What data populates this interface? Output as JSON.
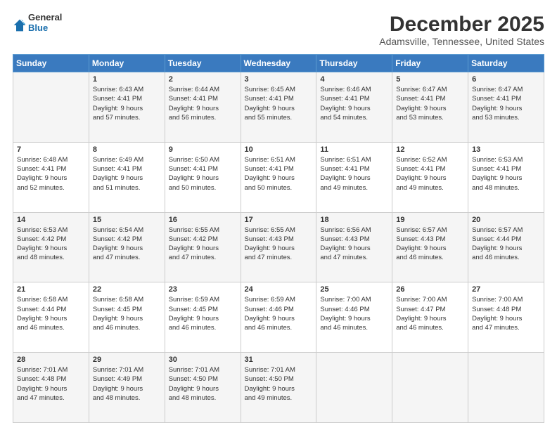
{
  "logo": {
    "line1": "General",
    "line2": "Blue"
  },
  "title": "December 2025",
  "location": "Adamsville, Tennessee, United States",
  "headers": [
    "Sunday",
    "Monday",
    "Tuesday",
    "Wednesday",
    "Thursday",
    "Friday",
    "Saturday"
  ],
  "weeks": [
    [
      {
        "day": "",
        "info": ""
      },
      {
        "day": "1",
        "info": "Sunrise: 6:43 AM\nSunset: 4:41 PM\nDaylight: 9 hours\nand 57 minutes."
      },
      {
        "day": "2",
        "info": "Sunrise: 6:44 AM\nSunset: 4:41 PM\nDaylight: 9 hours\nand 56 minutes."
      },
      {
        "day": "3",
        "info": "Sunrise: 6:45 AM\nSunset: 4:41 PM\nDaylight: 9 hours\nand 55 minutes."
      },
      {
        "day": "4",
        "info": "Sunrise: 6:46 AM\nSunset: 4:41 PM\nDaylight: 9 hours\nand 54 minutes."
      },
      {
        "day": "5",
        "info": "Sunrise: 6:47 AM\nSunset: 4:41 PM\nDaylight: 9 hours\nand 53 minutes."
      },
      {
        "day": "6",
        "info": "Sunrise: 6:47 AM\nSunset: 4:41 PM\nDaylight: 9 hours\nand 53 minutes."
      }
    ],
    [
      {
        "day": "7",
        "info": "Sunrise: 6:48 AM\nSunset: 4:41 PM\nDaylight: 9 hours\nand 52 minutes."
      },
      {
        "day": "8",
        "info": "Sunrise: 6:49 AM\nSunset: 4:41 PM\nDaylight: 9 hours\nand 51 minutes."
      },
      {
        "day": "9",
        "info": "Sunrise: 6:50 AM\nSunset: 4:41 PM\nDaylight: 9 hours\nand 50 minutes."
      },
      {
        "day": "10",
        "info": "Sunrise: 6:51 AM\nSunset: 4:41 PM\nDaylight: 9 hours\nand 50 minutes."
      },
      {
        "day": "11",
        "info": "Sunrise: 6:51 AM\nSunset: 4:41 PM\nDaylight: 9 hours\nand 49 minutes."
      },
      {
        "day": "12",
        "info": "Sunrise: 6:52 AM\nSunset: 4:41 PM\nDaylight: 9 hours\nand 49 minutes."
      },
      {
        "day": "13",
        "info": "Sunrise: 6:53 AM\nSunset: 4:41 PM\nDaylight: 9 hours\nand 48 minutes."
      }
    ],
    [
      {
        "day": "14",
        "info": "Sunrise: 6:53 AM\nSunset: 4:42 PM\nDaylight: 9 hours\nand 48 minutes."
      },
      {
        "day": "15",
        "info": "Sunrise: 6:54 AM\nSunset: 4:42 PM\nDaylight: 9 hours\nand 47 minutes."
      },
      {
        "day": "16",
        "info": "Sunrise: 6:55 AM\nSunset: 4:42 PM\nDaylight: 9 hours\nand 47 minutes."
      },
      {
        "day": "17",
        "info": "Sunrise: 6:55 AM\nSunset: 4:43 PM\nDaylight: 9 hours\nand 47 minutes."
      },
      {
        "day": "18",
        "info": "Sunrise: 6:56 AM\nSunset: 4:43 PM\nDaylight: 9 hours\nand 47 minutes."
      },
      {
        "day": "19",
        "info": "Sunrise: 6:57 AM\nSunset: 4:43 PM\nDaylight: 9 hours\nand 46 minutes."
      },
      {
        "day": "20",
        "info": "Sunrise: 6:57 AM\nSunset: 4:44 PM\nDaylight: 9 hours\nand 46 minutes."
      }
    ],
    [
      {
        "day": "21",
        "info": "Sunrise: 6:58 AM\nSunset: 4:44 PM\nDaylight: 9 hours\nand 46 minutes."
      },
      {
        "day": "22",
        "info": "Sunrise: 6:58 AM\nSunset: 4:45 PM\nDaylight: 9 hours\nand 46 minutes."
      },
      {
        "day": "23",
        "info": "Sunrise: 6:59 AM\nSunset: 4:45 PM\nDaylight: 9 hours\nand 46 minutes."
      },
      {
        "day": "24",
        "info": "Sunrise: 6:59 AM\nSunset: 4:46 PM\nDaylight: 9 hours\nand 46 minutes."
      },
      {
        "day": "25",
        "info": "Sunrise: 7:00 AM\nSunset: 4:46 PM\nDaylight: 9 hours\nand 46 minutes."
      },
      {
        "day": "26",
        "info": "Sunrise: 7:00 AM\nSunset: 4:47 PM\nDaylight: 9 hours\nand 46 minutes."
      },
      {
        "day": "27",
        "info": "Sunrise: 7:00 AM\nSunset: 4:48 PM\nDaylight: 9 hours\nand 47 minutes."
      }
    ],
    [
      {
        "day": "28",
        "info": "Sunrise: 7:01 AM\nSunset: 4:48 PM\nDaylight: 9 hours\nand 47 minutes."
      },
      {
        "day": "29",
        "info": "Sunrise: 7:01 AM\nSunset: 4:49 PM\nDaylight: 9 hours\nand 48 minutes."
      },
      {
        "day": "30",
        "info": "Sunrise: 7:01 AM\nSunset: 4:50 PM\nDaylight: 9 hours\nand 48 minutes."
      },
      {
        "day": "31",
        "info": "Sunrise: 7:01 AM\nSunset: 4:50 PM\nDaylight: 9 hours\nand 49 minutes."
      },
      {
        "day": "",
        "info": ""
      },
      {
        "day": "",
        "info": ""
      },
      {
        "day": "",
        "info": ""
      }
    ]
  ]
}
